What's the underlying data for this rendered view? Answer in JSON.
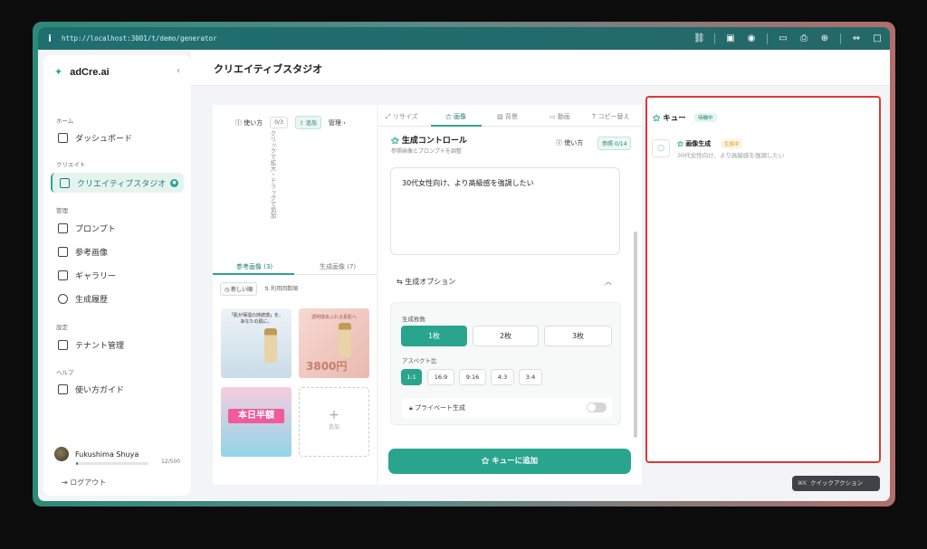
{
  "browser": {
    "url": "http://localhost:3001/t/demo/generator"
  },
  "app": {
    "name": "adCre.ai"
  },
  "sidebar": {
    "sections": [
      {
        "label": "ホーム"
      },
      {
        "label": "クリエイト"
      },
      {
        "label": "管理"
      },
      {
        "label": "設定"
      },
      {
        "label": "ヘルプ"
      }
    ],
    "items": [
      {
        "label": "ダッシュボード"
      },
      {
        "label": "クリエイティブスタジオ"
      },
      {
        "label": "プロンプト"
      },
      {
        "label": "参考画像"
      },
      {
        "label": "ギャラリー"
      },
      {
        "label": "生成履歴"
      },
      {
        "label": "テナント管理"
      },
      {
        "label": "使い方ガイド"
      }
    ],
    "user": {
      "name": "Fukushima Shuya",
      "usage_text": "12/500",
      "usage_fraction": 0.024
    },
    "logout_label": "ログアウト"
  },
  "page": {
    "title": "クリエイティブスタジオ"
  },
  "refpanel": {
    "howto": "使い方",
    "count": "0/3",
    "add_label": "追加",
    "manage_label": "管理",
    "drop_hint": "クリックで拡大・ドラッグで追加",
    "tabs": [
      {
        "label": "参考画像 (3)"
      },
      {
        "label": "生成画像 (7)"
      }
    ],
    "sort": [
      {
        "label": "新しい順"
      },
      {
        "label": "利用回数順"
      }
    ],
    "thumb1": {
      "line1": "「肌が保湿の持続感」を、",
      "line2": "あなたの肌に。"
    },
    "thumb2": {
      "headline": "透明感あふれる素肌へ",
      "price": "3800円"
    },
    "thumb3": {
      "headline": "本日半額"
    },
    "add_slot_label": "追加"
  },
  "midpanel": {
    "tabs": [
      {
        "label": "リサイズ"
      },
      {
        "label": "画像"
      },
      {
        "label": "背景"
      },
      {
        "label": "動画"
      },
      {
        "label": "コピー替え"
      }
    ],
    "section_title": "生成コントロール",
    "section_sub": "参照画像とプロンプトを調整",
    "howto": "使い方",
    "ref_count": "参照 0/14",
    "prompt_text": "30代女性向け、より高級感を強調したい",
    "options_title": "生成オプション",
    "count_label": "生成枚数",
    "count_options": [
      {
        "label": "1枚"
      },
      {
        "label": "2枚"
      },
      {
        "label": "3枚"
      }
    ],
    "aspect_label": "アスペクト比",
    "aspect_options": [
      {
        "label": "1:1"
      },
      {
        "label": "16:9"
      },
      {
        "label": "9:16"
      },
      {
        "label": "4:3"
      },
      {
        "label": "3:4"
      }
    ],
    "private_label": "プライベート生成",
    "submit_label": "キューに追加"
  },
  "queue": {
    "title": "キュー",
    "badge": "待機中",
    "item": {
      "name": "画像生成",
      "status": "生成中",
      "desc": "30代女性向け、より高級感を強調したい"
    }
  },
  "quick_action": {
    "shortcut": "⌘K",
    "label": "クイックアクション"
  }
}
